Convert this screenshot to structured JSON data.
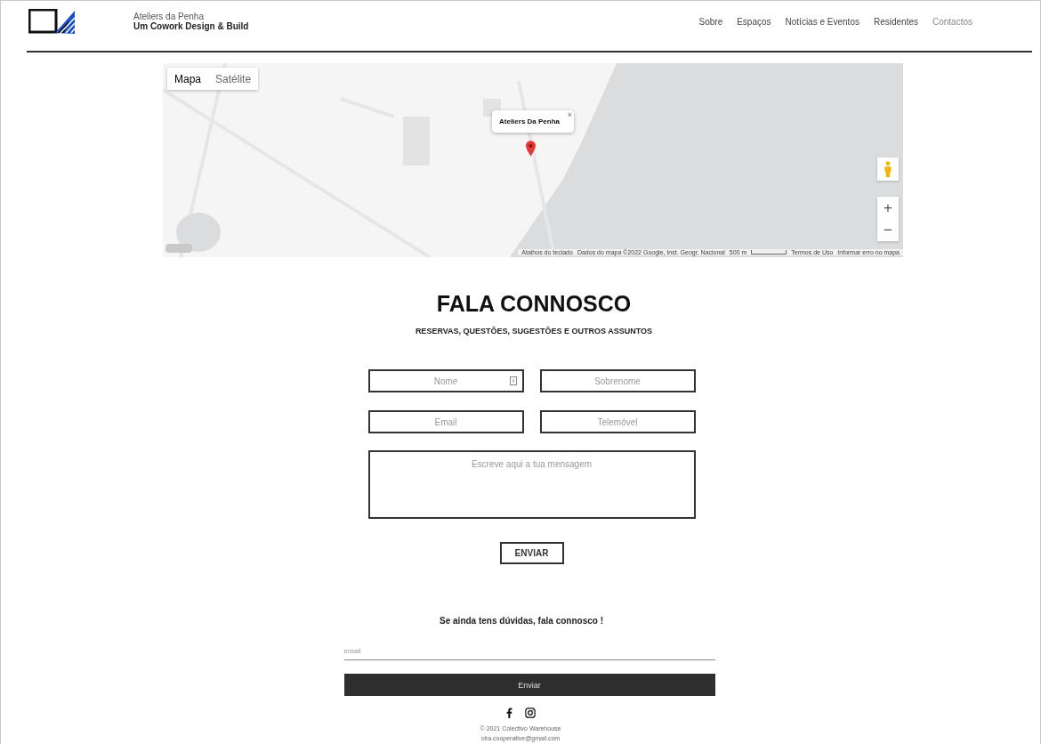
{
  "header": {
    "site_name": "Ateliers da Penha",
    "tagline": "Um Cowork Design & Build",
    "nav": [
      {
        "label": "Sobre",
        "selected": false
      },
      {
        "label": "Espaços",
        "selected": false
      },
      {
        "label": "Notícias e Eventos",
        "selected": false
      },
      {
        "label": "Residentes",
        "selected": false
      },
      {
        "label": "Contactos",
        "selected": true
      }
    ]
  },
  "map": {
    "types": [
      {
        "label": "Mapa",
        "selected": true
      },
      {
        "label": "Satélite",
        "selected": false
      }
    ],
    "info_window": {
      "title": "Ateliers Da Penha",
      "close": "×"
    },
    "zoom_in": "+",
    "zoom_out": "−",
    "attribution": [
      "Atalhos do teclado",
      "Dados do mapa ©2022 Google, Inst. Geogr. Nacional",
      "500 m",
      "Termos de Uso",
      "Informar erro no mapa"
    ]
  },
  "contact": {
    "title": "FALA CONNOSCO",
    "subtitle": "RESERVAS, QUESTÕES, SUGESTÕES E OUTROS ASSUNTOS",
    "fields": [
      {
        "placeholder": "Nome"
      },
      {
        "placeholder": "Sobrenome"
      },
      {
        "placeholder": "Email"
      },
      {
        "placeholder": "Telemóvel"
      }
    ],
    "message": {
      "placeholder": "Escreve aqui a tua mensagem"
    },
    "submit": "ENVIAR"
  },
  "newsletter": {
    "title": "Se ainda tens dúvidas, fala connosco !",
    "email": {
      "placeholder": "email"
    },
    "submit": "Enviar"
  },
  "footer": {
    "copyright": "© 2021 Colectivo Warehouse",
    "email": "cêa.cooperative@gmail.com"
  }
}
